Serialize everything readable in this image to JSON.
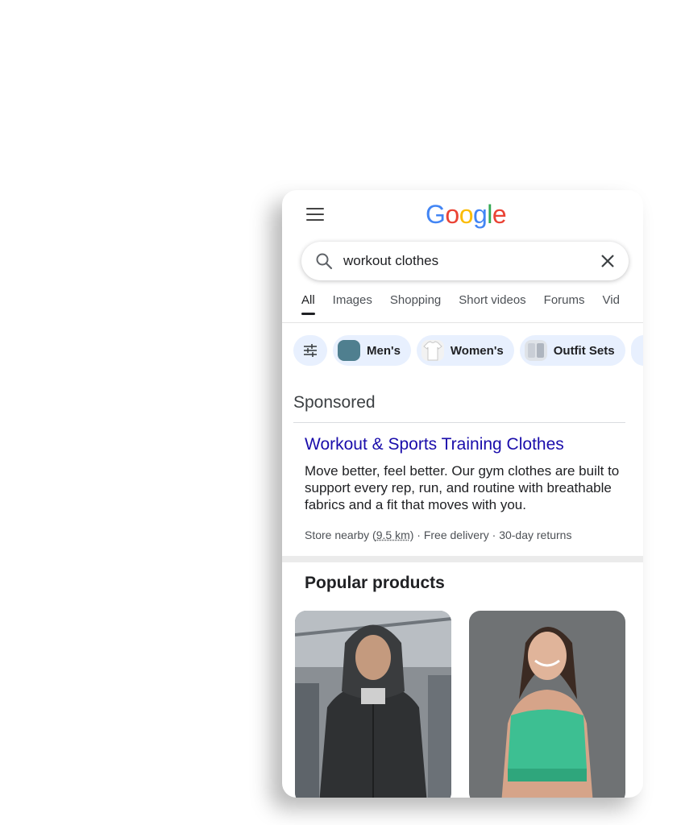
{
  "logo": {
    "letters": [
      "G",
      "o",
      "o",
      "g",
      "l",
      "e"
    ],
    "colors": [
      "#4285F4",
      "#EA4335",
      "#FBBC05",
      "#4285F4",
      "#34A853",
      "#EA4335"
    ]
  },
  "search": {
    "query": "workout clothes",
    "search_icon": "search-icon",
    "clear_icon": "close-icon"
  },
  "tabs": [
    {
      "label": "All",
      "active": true
    },
    {
      "label": "Images"
    },
    {
      "label": "Shopping"
    },
    {
      "label": "Short videos"
    },
    {
      "label": "Forums"
    },
    {
      "label": "Vid"
    }
  ],
  "chips": [
    {
      "label": "",
      "icon": "filter-sliders-icon"
    },
    {
      "label": "Men's"
    },
    {
      "label": "Women's"
    },
    {
      "label": "Outfit Sets"
    }
  ],
  "sponsored": {
    "label": "Sponsored",
    "title": "Workout & Sports Training Clothes",
    "description": "Move better, feel better. Our gym clothes are built to support every rep, run, and routine with breathable fabrics and a fit that moves with you.",
    "meta_prefix": "Store nearby (",
    "distance": "9.5 km",
    "meta_suffix": ") · Free delivery · 30-day returns"
  },
  "popular": {
    "heading": "Popular products"
  },
  "colors": {
    "link": "#1a0dab",
    "chip_bg": "#e8f0fe"
  }
}
